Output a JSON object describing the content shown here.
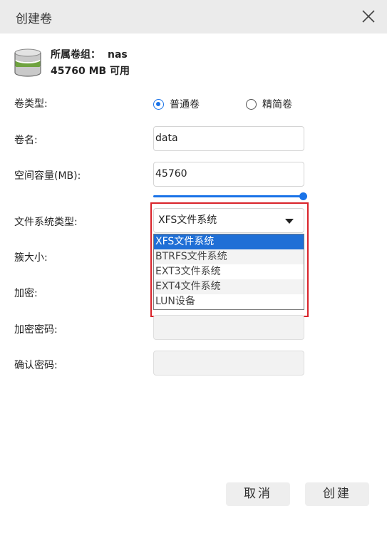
{
  "dialog": {
    "title": "创建卷"
  },
  "volume_group": {
    "label": "所属卷组：",
    "name": "nas",
    "capacity": "45760 MB 可用"
  },
  "fields": {
    "volume_type": {
      "label": "卷类型:",
      "options": [
        "普通卷",
        "精简卷"
      ],
      "selected": "普通卷"
    },
    "volume_name": {
      "label": "卷名:",
      "value": "data"
    },
    "capacity": {
      "label": "空间容量(MB):",
      "value": "45760",
      "slider_fraction": 1.0
    },
    "fs_type": {
      "label": "文件系统类型:",
      "value": "XFS文件系统",
      "options": [
        "XFS文件系统",
        "BTRFS文件系统",
        "EXT3文件系统",
        "EXT4文件系统",
        "LUN设备"
      ]
    },
    "cluster_size": {
      "label": "簇大小:"
    },
    "encryption": {
      "label": "加密:"
    },
    "encryption_password": {
      "label": "加密密码:"
    },
    "confirm_password": {
      "label": "确认密码:"
    }
  },
  "buttons": {
    "cancel": "取消",
    "create": "创建"
  },
  "icons": {
    "close": "close-icon",
    "volume_group": "database-icon",
    "dropdown": "caret-down-icon"
  },
  "colors": {
    "accent": "#1a73e8",
    "highlight": "#d9232a",
    "selected_option": "#1f6fd6"
  }
}
